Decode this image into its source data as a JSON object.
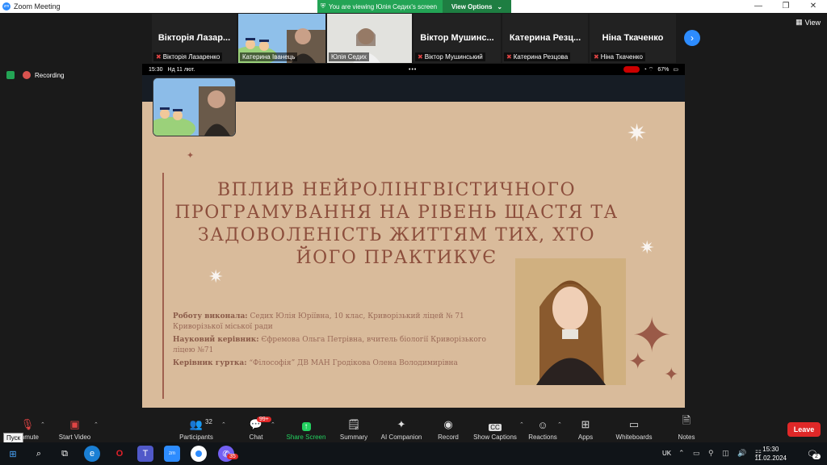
{
  "window": {
    "title": "Zoom Meeting",
    "logo": "zoom"
  },
  "banner": {
    "viewing": "You are viewing Юлія Седих's screen",
    "options": "View Options"
  },
  "gallery": [
    {
      "display_name": "Вікторія Лазар...",
      "label": "Вікторія Лазаренко",
      "video": false
    },
    {
      "display_name": "",
      "label": "Катерина Іванець",
      "video": true
    },
    {
      "display_name": "",
      "label": "Юлія Седих",
      "video": true
    },
    {
      "display_name": "Віктор Мушинс...",
      "label": "Віктор Мушинський",
      "video": false
    },
    {
      "display_name": "Катерина Резц...",
      "label": "Катерина Резцова",
      "video": false
    },
    {
      "display_name": "Ніна Ткаченко",
      "label": "Ніна Ткаченко",
      "video": false
    }
  ],
  "view_label": "View",
  "recording_label": "Recording",
  "phone": {
    "time": "15:30",
    "date": "Нд 11 лют.",
    "battery": "67%"
  },
  "slide": {
    "title_lines": [
      "ВПЛИВ НЕЙРОЛІНГВІСТИЧНОГО",
      "ПРОГРАМУВАННЯ НА РІВЕНЬ ЩАСТЯ ТА",
      "ЗАДОВОЛЕНІСТЬ ЖИТТЯМ ТИХ, ХТО",
      "ЙОГО ПРАКТИКУЄ"
    ],
    "author_label": "Роботу виконала:",
    "author_text": "Седих Юлія Юріївна, 10 клас, Криворізький ліцей № 71 Криворізької міської ради",
    "supervisor_label": "Науковий керівник:",
    "supervisor_text": "Єфремова Ольга Петрівна, вчитель біології Криворізького ліцею №71",
    "club_label": "Керівник гуртка:",
    "club_text": "“Філософія” ДВ МАН Гродікова Олена Володимирівна"
  },
  "toolbar": {
    "unmute": "Unmute",
    "start_video": "Start Video",
    "participants": "Participants",
    "participants_count": "32",
    "chat": "Chat",
    "chat_badge": "99+",
    "share": "Share Screen",
    "summary": "Summary",
    "ai": "AI Companion",
    "record": "Record",
    "captions": "Show Captions",
    "reactions": "Reactions",
    "apps": "Apps",
    "whiteboards": "Whiteboards",
    "notes": "Notes",
    "leave": "Leave"
  },
  "tooltip": "Пуск",
  "taskbar": {
    "lang": "UK",
    "time": "15:30",
    "date": "11.02.2024",
    "notif_count": "2",
    "viber_badge": "35"
  },
  "colors": {
    "accent": "#2d8cff",
    "leave": "#e02828",
    "share": "#23d160",
    "slide_bg": "#d9bb9b",
    "slide_title": "#8c4e3c"
  }
}
